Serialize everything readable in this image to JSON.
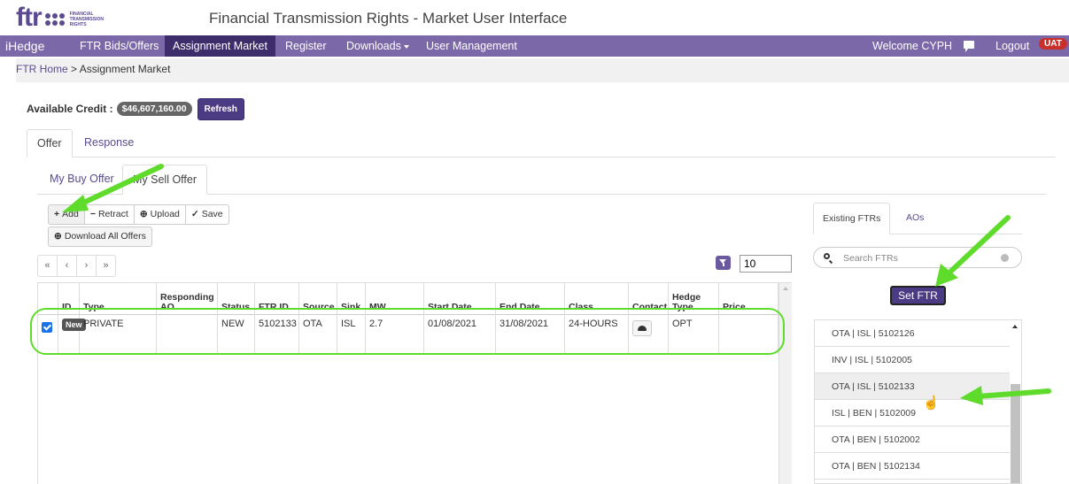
{
  "header": {
    "logo_text": "ftr",
    "logo_subtext": [
      "FINANCIAL",
      "TRANSMISSION",
      "RIGHTS"
    ],
    "title": "Financial Transmission Rights - Market User Interface"
  },
  "navbar": {
    "brand": "iHedge",
    "items": [
      "FTR Bids/Offers",
      "Assignment Market",
      "Register",
      "Downloads",
      "User Management"
    ],
    "active": "Assignment Market",
    "welcome": "Welcome CYPH",
    "logout": "Logout",
    "env_badge": "UAT"
  },
  "breadcrumb": {
    "home": "FTR Home",
    "separator": ">",
    "current": "Assignment Market"
  },
  "credit": {
    "label": "Available Credit :",
    "amount": "$46,607,160.00",
    "refresh_label": "Refresh"
  },
  "tabs_main": [
    "Offer",
    "Response"
  ],
  "tabs_sub": [
    "My Buy Offer",
    "My Sell Offer"
  ],
  "toolbar": {
    "add": "Add",
    "retract": "Retract",
    "upload": "Upload",
    "save": "Save",
    "download_all": "Download All Offers"
  },
  "pager": [
    "«",
    "‹",
    "›",
    "»"
  ],
  "page_size": "10",
  "grid": {
    "columns": [
      "ID",
      "Type",
      "Responding AO",
      "Status",
      "FTR ID",
      "Source",
      "Sink",
      "MW",
      "Start Date",
      "End Date",
      "Class",
      "Contact",
      "Hedge Type",
      "Price"
    ],
    "rows": [
      {
        "checked": true,
        "id": "New",
        "type": "PRIVATE",
        "responding_ao": "",
        "status": "NEW",
        "ftr_id": "5102133",
        "source": "OTA",
        "sink": "ISL",
        "mw": "2.7",
        "start_date": "01/08/2021",
        "end_date": "31/08/2021",
        "class": "24-HOURS",
        "hedge_type": "OPT",
        "price": ""
      }
    ]
  },
  "right_panel": {
    "tabs": [
      "Existing FTRs",
      "AOs"
    ],
    "search_placeholder": "Search FTRs",
    "set_ftr_label": "Set FTR",
    "ftr_list": [
      "OTA | ISL | 5102126",
      "INV | ISL | 5102005",
      "OTA | ISL | 5102133",
      "ISL | BEN | 5102009",
      "OTA | BEN | 5102002",
      "OTA | BEN | 5102134"
    ],
    "selected_index": 2
  },
  "colors": {
    "brand_purple": "#7b68a8",
    "active_nav": "#3d2d6b",
    "button_purple": "#4b3a84",
    "annotation_green": "#5fdc2b",
    "uat_red": "#c9302c"
  }
}
